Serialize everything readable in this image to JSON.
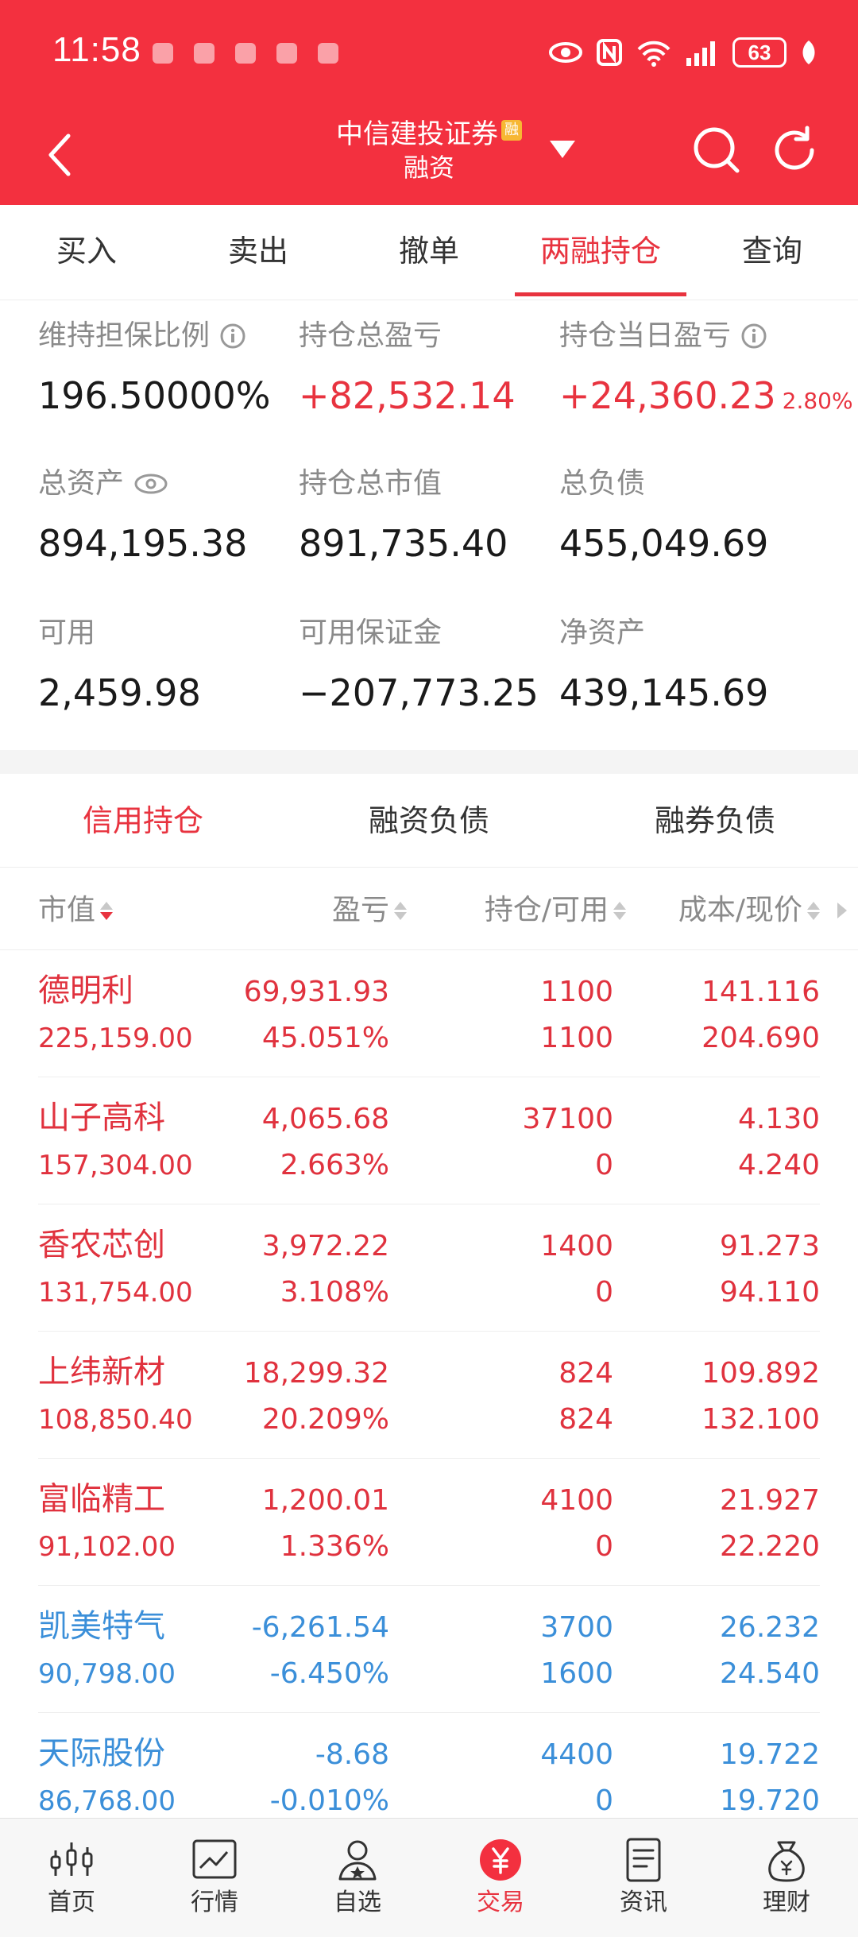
{
  "status_bar": {
    "time": "11:58",
    "battery": "63"
  },
  "header": {
    "title": "中信建投证券",
    "badge": "融",
    "subtitle": "融资"
  },
  "tabs": [
    {
      "label": "买入"
    },
    {
      "label": "卖出"
    },
    {
      "label": "撤单"
    },
    {
      "label": "两融持仓"
    },
    {
      "label": "查询"
    }
  ],
  "summary": {
    "maintenance_ratio": {
      "label": "维持担保比例",
      "value": "196.50000%"
    },
    "total_pl": {
      "label": "持仓总盈亏",
      "value": "+82,532.14"
    },
    "daily_pl": {
      "label": "持仓当日盈亏",
      "value": "+24,360.23",
      "pct": "2.80%"
    },
    "total_assets": {
      "label": "总资产",
      "value": "894,195.38"
    },
    "total_market_value": {
      "label": "持仓总市值",
      "value": "891,735.40"
    },
    "total_liabilities": {
      "label": "总负债",
      "value": "455,049.69"
    },
    "available": {
      "label": "可用",
      "value": "2,459.98"
    },
    "available_margin": {
      "label": "可用保证金",
      "value": "−207,773.25"
    },
    "net_assets": {
      "label": "净资产",
      "value": "439,145.69"
    }
  },
  "subtabs": [
    {
      "label": "信用持仓"
    },
    {
      "label": "融资负债"
    },
    {
      "label": "融券负债"
    }
  ],
  "columns": {
    "market_value": "市值",
    "pl": "盈亏",
    "position": "持仓/可用",
    "cost": "成本/现价"
  },
  "holdings": [
    {
      "name": "德明利",
      "market_value": "225,159.00",
      "pl": "69,931.93",
      "pl_pct": "45.051%",
      "position": "1100",
      "available": "1100",
      "cost": "141.116",
      "price": "204.690"
    },
    {
      "name": "山子高科",
      "market_value": "157,304.00",
      "pl": "4,065.68",
      "pl_pct": "2.663%",
      "position": "37100",
      "available": "0",
      "cost": "4.130",
      "price": "4.240"
    },
    {
      "name": "香农芯创",
      "market_value": "131,754.00",
      "pl": "3,972.22",
      "pl_pct": "3.108%",
      "position": "1400",
      "available": "0",
      "cost": "91.273",
      "price": "94.110"
    },
    {
      "name": "上纬新材",
      "market_value": "108,850.40",
      "pl": "18,299.32",
      "pl_pct": "20.209%",
      "position": "824",
      "available": "824",
      "cost": "109.892",
      "price": "132.100"
    },
    {
      "name": "富临精工",
      "market_value": "91,102.00",
      "pl": "1,200.01",
      "pl_pct": "1.336%",
      "position": "4100",
      "available": "0",
      "cost": "21.927",
      "price": "22.220"
    },
    {
      "name": "凯美特气",
      "market_value": "90,798.00",
      "pl": "-6,261.54",
      "pl_pct": "-6.450%",
      "position": "3700",
      "available": "1600",
      "cost": "26.232",
      "price": "24.540"
    },
    {
      "name": "天际股份",
      "market_value": "86,768.00",
      "pl": "-8.68",
      "pl_pct": "-0.010%",
      "position": "4400",
      "available": "0",
      "cost": "19.722",
      "price": "19.720"
    }
  ],
  "bottom_nav": [
    {
      "label": "首页",
      "icon": "candlestick-icon"
    },
    {
      "label": "行情",
      "icon": "chart-line-icon"
    },
    {
      "label": "自选",
      "icon": "user-star-icon"
    },
    {
      "label": "交易",
      "icon": "yuan-icon"
    },
    {
      "label": "资讯",
      "icon": "document-icon"
    },
    {
      "label": "理财",
      "icon": "money-bag-icon"
    }
  ],
  "colors": {
    "brand_red": "#f3303f",
    "gain": "#e0323e",
    "loss": "#3b8fd9"
  }
}
